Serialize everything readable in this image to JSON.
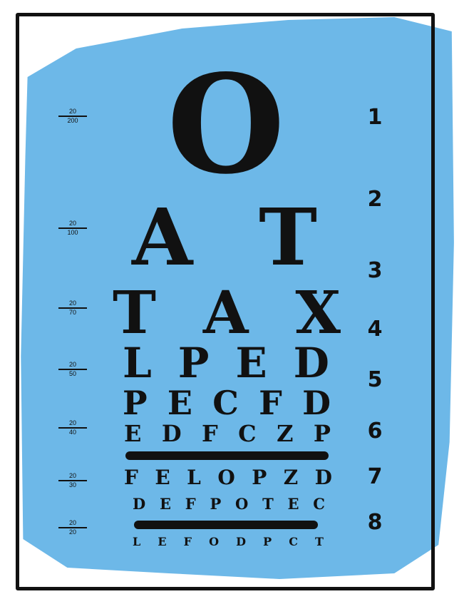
{
  "chart_title": "",
  "rows": [
    {
      "letters": [
        "O"
      ]
    },
    {
      "letters": [
        "A",
        "T"
      ]
    },
    {
      "letters": [
        "T",
        "A",
        "X"
      ]
    },
    {
      "letters": [
        "L",
        "P",
        "E",
        "D"
      ]
    },
    {
      "letters": [
        "P",
        "E",
        "C",
        "F",
        "D"
      ]
    },
    {
      "letters": [
        "E",
        "D",
        "F",
        "C",
        "Z",
        "P"
      ]
    },
    {
      "letters": [
        "F",
        "E",
        "L",
        "O",
        "P",
        "Z",
        "D"
      ]
    },
    {
      "letters": [
        "D",
        "E",
        "F",
        "P",
        "O",
        "T",
        "E",
        "C"
      ]
    },
    {
      "letters": [
        "L",
        "E",
        "F",
        "O",
        "D",
        "P",
        "C",
        "T"
      ]
    }
  ],
  "acuity_labels": [
    {
      "top": "20",
      "bottom": "200"
    },
    {
      "top": "20",
      "bottom": "100"
    },
    {
      "top": "20",
      "bottom": "70"
    },
    {
      "top": "20",
      "bottom": "50"
    },
    {
      "top": "20",
      "bottom": "40"
    },
    {
      "top": "20",
      "bottom": "30"
    },
    {
      "top": "20",
      "bottom": "20"
    }
  ],
  "line_numbers": [
    "1",
    "2",
    "3",
    "4",
    "5",
    "6",
    "7",
    "8"
  ],
  "colors": {
    "background_blue": "#6db8e8",
    "ink": "#111111"
  }
}
